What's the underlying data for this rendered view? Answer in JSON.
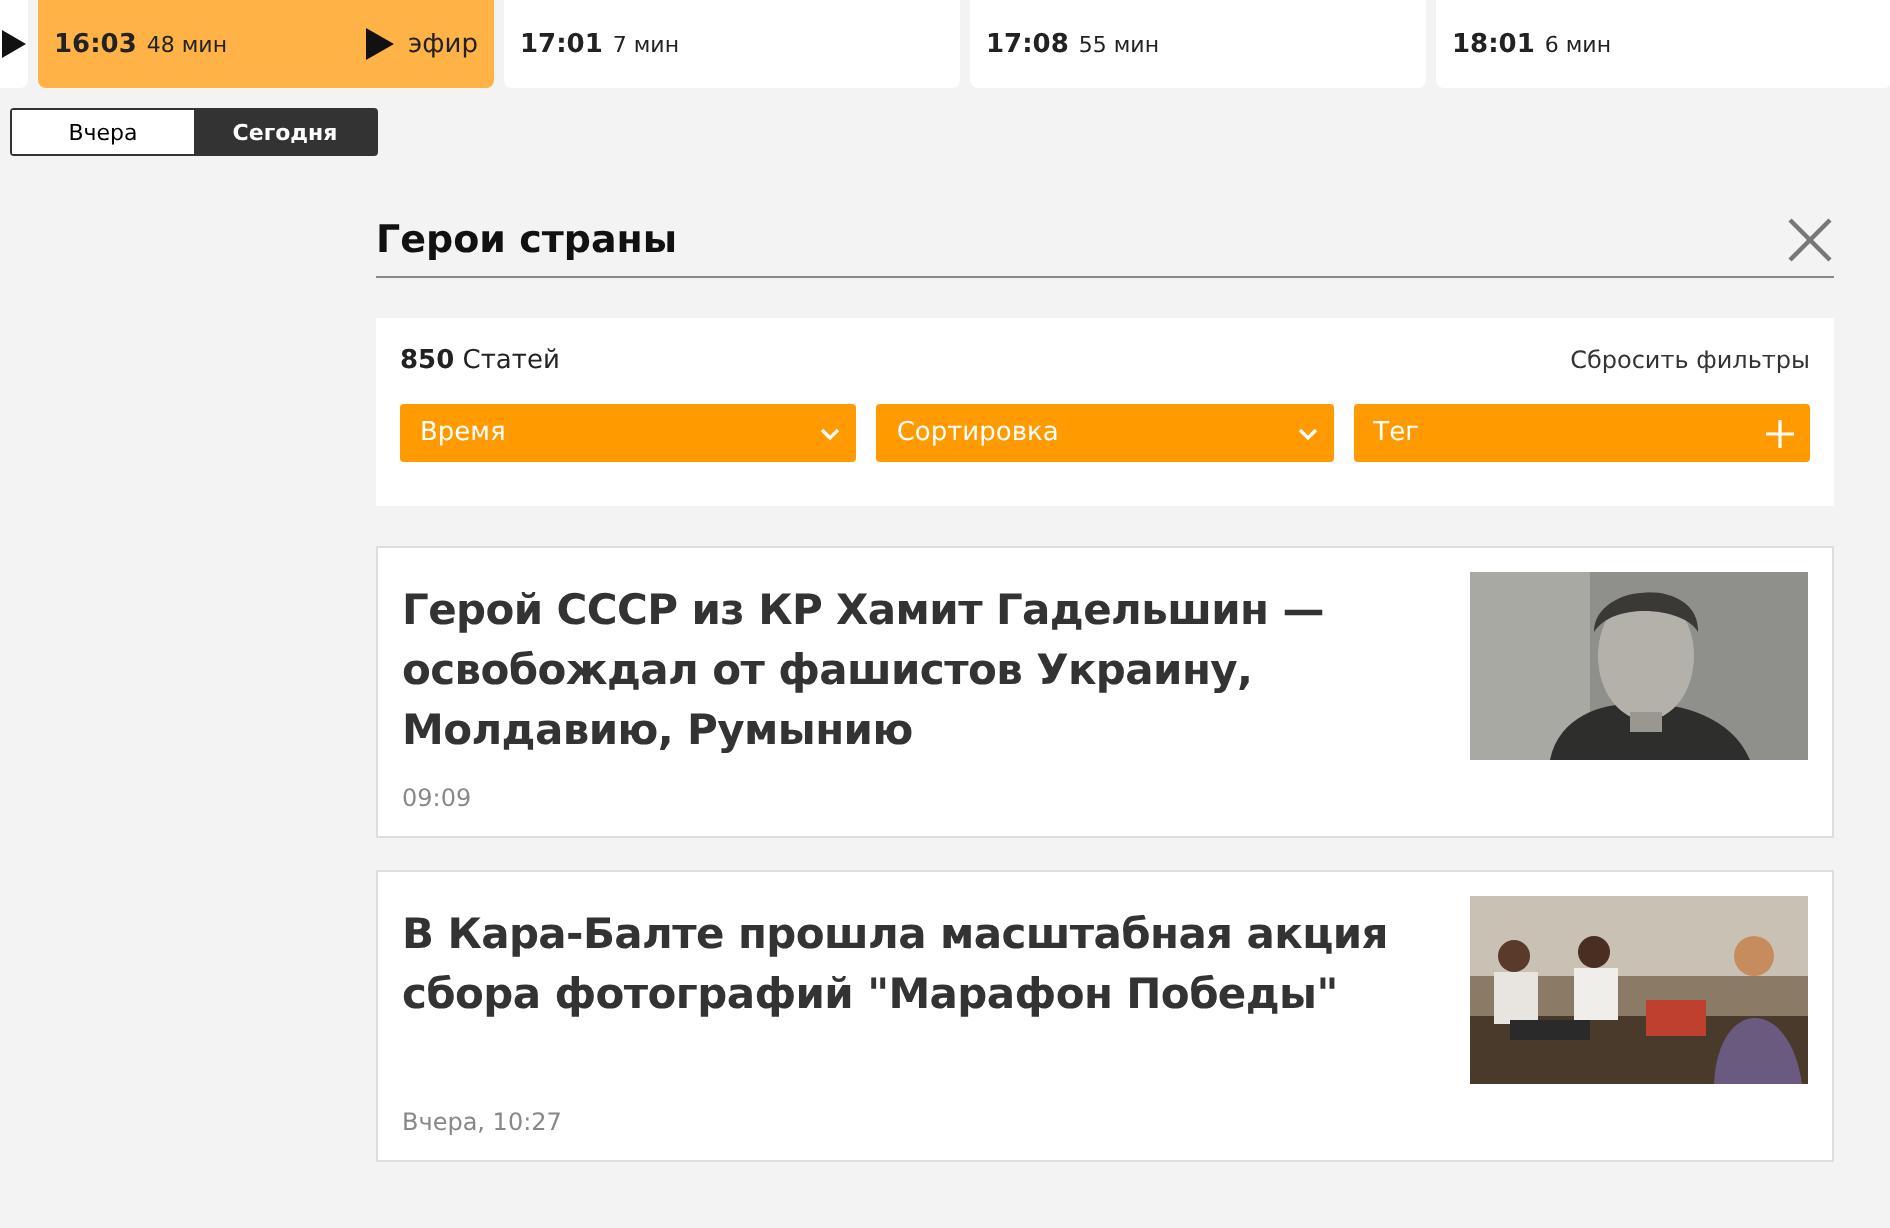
{
  "schedule": [
    {
      "time": "16:03",
      "duration": "48 мин",
      "selected": true,
      "live": "эфир"
    },
    {
      "time": "17:01",
      "duration": "7 мин",
      "selected": false
    },
    {
      "time": "17:08",
      "duration": "55 мин",
      "selected": false
    },
    {
      "time": "18:01",
      "duration": "6 мин",
      "selected": false
    }
  ],
  "day_tabs": [
    {
      "label": "Вчера",
      "selected": false
    },
    {
      "label": "Сегодня",
      "selected": true
    }
  ],
  "section": {
    "title": "Герои страны"
  },
  "filters": {
    "count": "850",
    "count_label": "Статей",
    "reset": "Сбросить фильтры",
    "dropdowns": [
      {
        "label": "Время",
        "kind": "select"
      },
      {
        "label": "Сортировка",
        "kind": "select"
      },
      {
        "label": "Тег",
        "kind": "add"
      }
    ]
  },
  "articles": [
    {
      "title": "Герой СССР из КР Хамит Гадельшин — освобождал от фашистов Украину, Молдавию, Румынию",
      "time": "09:09"
    },
    {
      "title": "В Кара-Балте прошла масштабная акция сбора фотографий \"Марафон Победы\"",
      "time": "Вчера, 10:27"
    }
  ]
}
